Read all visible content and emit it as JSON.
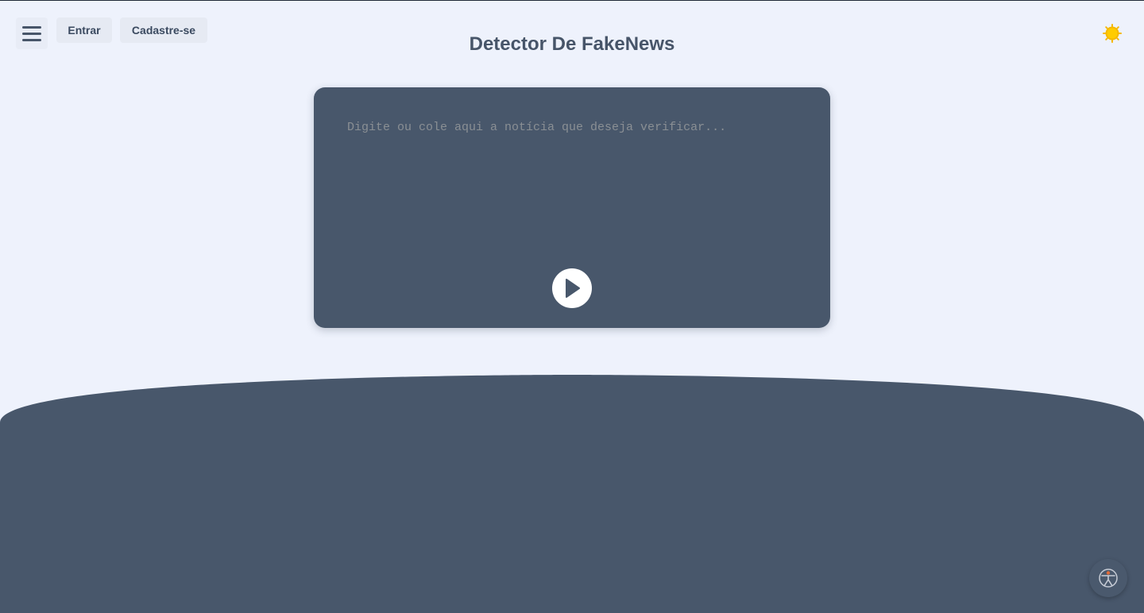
{
  "header": {
    "title": "Detector De FakeNews",
    "login_label": "Entrar",
    "signup_label": "Cadastre-se"
  },
  "icons": {
    "menu": "hamburger-menu-icon",
    "theme": "sun-icon",
    "submit": "play-icon",
    "accessibility": "accessibility-icon"
  },
  "checker": {
    "placeholder": "Digite ou cole aqui a notícia que deseja verificar...",
    "value": ""
  },
  "colors": {
    "background": "#eef2fc",
    "card": "#48576b",
    "accent_sun": "#f5b800",
    "text": "#475569"
  }
}
